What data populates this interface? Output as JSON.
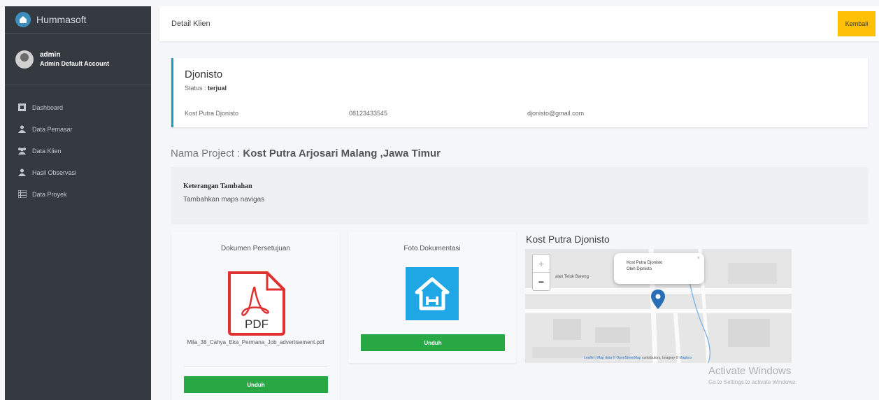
{
  "sidebar": {
    "brand": "Hummasoft",
    "user": {
      "name": "admin",
      "role": "Admin Default Account"
    },
    "menu": [
      {
        "label": "Dashboard",
        "icon": "dashboard-icon"
      },
      {
        "label": "Data Pemasar",
        "icon": "user-icon"
      },
      {
        "label": "Data Klien",
        "icon": "users-icon"
      },
      {
        "label": "Hasil Observasi",
        "icon": "user-icon"
      },
      {
        "label": "Data Proyek",
        "icon": "list-icon"
      }
    ]
  },
  "header": {
    "title": "Detail Klien",
    "back_label": "Kembali"
  },
  "client": {
    "name": "Djonisto",
    "status_label": "Status :",
    "status_value": "terjual",
    "kost": "Kost Putra Djonisto",
    "phone": "08123433545",
    "email": "djonisto@gmail.com"
  },
  "project": {
    "label": "Nama Project :",
    "name": "Kost Putra Arjosari Malang ,Jawa Timur"
  },
  "note": {
    "title": "Keterangan Tambahan",
    "text": "Tambahkan maps navigas"
  },
  "documents": {
    "title": "Dokumen Persetujuan",
    "pdf_label": "PDF",
    "file_name": "Mila_38_Cahya_Eka_Permana_Job_advertisement.pdf",
    "download_label": "Unduh"
  },
  "photo": {
    "title": "Foto Dokumentasi",
    "download_label": "Unduh"
  },
  "map": {
    "title": "Kost Putra Djonisto",
    "zoom_in": "+",
    "zoom_out": "−",
    "street": "alan Teluk Bareng",
    "popup_line1": "Kost Putra Djonisto",
    "popup_line2": "Oleh Djonisto",
    "popup_close": "×",
    "attribution_prefix": "Leaflet | Map data ©",
    "attribution_link1": "OpenStreetMap",
    "attribution_mid": "contributors, Imagery ©",
    "attribution_link2": "Mapbox"
  },
  "watermark": {
    "line1": "Activate Windows",
    "line2": "Go to Settings to activate Windows."
  },
  "colors": {
    "sidebar": "#343a40",
    "accent": "#17a2b8",
    "warning": "#ffc107",
    "success": "#28a745",
    "pdf": "#e03131",
    "photo": "#1ea7e4"
  }
}
